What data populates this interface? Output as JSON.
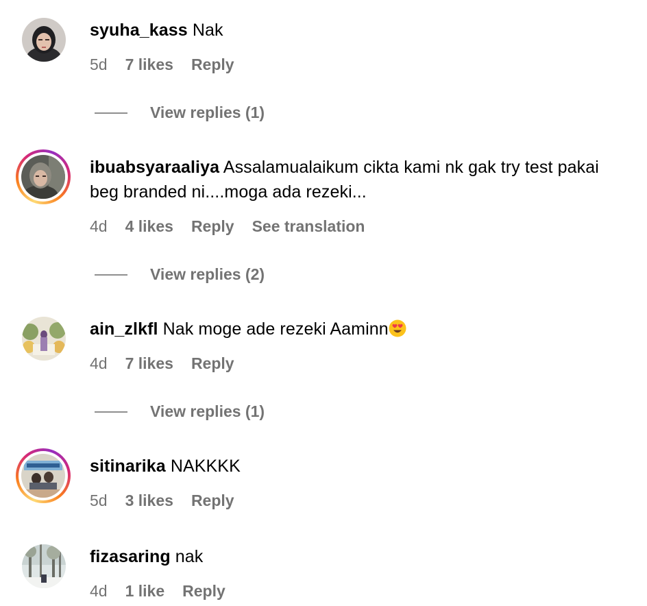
{
  "comments": [
    {
      "username": "syuha_kass",
      "text": "Nak",
      "age": "5d",
      "likes": "7 likes",
      "reply": "Reply",
      "view_replies": "View replies (1)"
    },
    {
      "username": "ibuabsyaraaliya",
      "text": "Assalamualaikum cikta kami nk gak try test pakai beg branded ni....moga ada rezeki...",
      "age": "4d",
      "likes": "4 likes",
      "reply": "Reply",
      "translation": "See translation",
      "view_replies": "View replies (2)"
    },
    {
      "username": "ain_zlkfl",
      "text": "Nak moge ade rezeki Aaminn",
      "emoji": "heart-eyes",
      "age": "4d",
      "likes": "7 likes",
      "reply": "Reply",
      "view_replies": "View replies (1)"
    },
    {
      "username": "sitinarika",
      "text": "NAKKKK",
      "age": "5d",
      "likes": "3 likes",
      "reply": "Reply"
    },
    {
      "username": "fizasaring",
      "text": "nak",
      "age": "4d",
      "likes": "1 like",
      "reply": "Reply"
    }
  ],
  "colors": {
    "meta_text": "#737373",
    "story_ring_start": "#feda75",
    "story_ring_mid": "#d62976",
    "story_ring_end": "#962fbf"
  }
}
